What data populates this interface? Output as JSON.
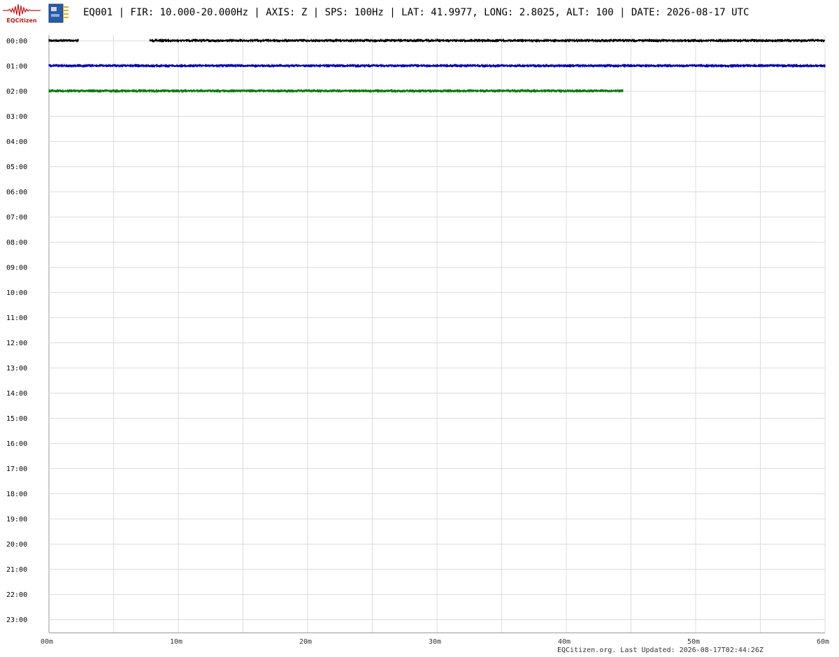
{
  "logo": {
    "text": "EQCitizen",
    "icon": "seismograph-waveform-logo"
  },
  "device": {
    "icon": "circuit-board-icon"
  },
  "header": {
    "title": "EQ001 | FIR: 10.000-20.000Hz | AXIS: Z | SPS: 100Hz | LAT: 41.9977, LONG: 2.8025, ALT: 100 | DATE: 2026-08-17 UTC"
  },
  "footer": {
    "text": "EQCitizen.org. Last Updated: 2026-08-17T02:44:26Z"
  },
  "chart_data": {
    "type": "line",
    "title": "",
    "xlabel": "",
    "ylabel": "",
    "grid": true,
    "xlim": [
      0,
      60
    ],
    "x_ticks": [
      "00m",
      "10m",
      "20m",
      "30m",
      "40m",
      "50m",
      "60m"
    ],
    "y_ticks": [
      "00:00",
      "01:00",
      "02:00",
      "03:00",
      "04:00",
      "05:00",
      "06:00",
      "07:00",
      "08:00",
      "09:00",
      "10:00",
      "11:00",
      "12:00",
      "13:00",
      "14:00",
      "15:00",
      "16:00",
      "17:00",
      "18:00",
      "19:00",
      "20:00",
      "21:00",
      "22:00",
      "23:00"
    ],
    "series": [
      {
        "hour": "00:00",
        "color": "#000000",
        "segments": [
          [
            0,
            2.3
          ],
          [
            7.8,
            60
          ]
        ]
      },
      {
        "hour": "01:00",
        "color": "#0000aa",
        "segments": [
          [
            0,
            60
          ]
        ]
      },
      {
        "hour": "02:00",
        "color": "#007700",
        "segments": [
          [
            0,
            44.4
          ]
        ]
      }
    ]
  }
}
